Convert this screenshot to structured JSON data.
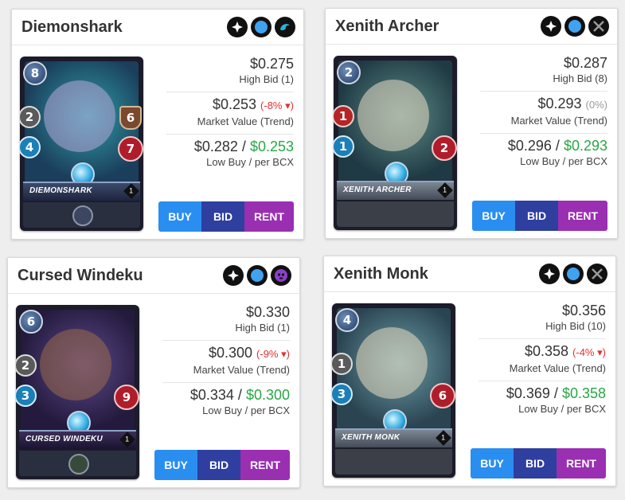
{
  "colors": {
    "buy": "#2a8ef0",
    "bid": "#2f3f9f",
    "rent": "#9a2fb2",
    "trend_negative": "#e03131",
    "low_buy_green": "#28a745"
  },
  "cards": [
    {
      "title": "Diemonshark",
      "card_name": "DIEMONSHARK",
      "level": "1",
      "icons": [
        "water-splash-icon",
        "blue-element-icon",
        "wave-icon"
      ],
      "stats": {
        "mana": "8",
        "attack": "2",
        "attack_type": "melee",
        "speed": "4",
        "armor": "6",
        "health": "7"
      },
      "high_bid": "$0.275",
      "high_bid_label": "High Bid (1)",
      "market_value": "$0.253",
      "trend": "(-8%",
      "trend_arrow": "▾",
      "trend_close": ")",
      "market_value_label": "Market Value (Trend)",
      "low_buy": "$0.282",
      "separator": " / ",
      "per_bcx": "$0.253",
      "low_buy_label": "Low Buy / per BCX",
      "buy_label": "BUY",
      "bid_label": "BID",
      "rent_label": "RENT"
    },
    {
      "title": "Xenith Archer",
      "card_name": "XENITH ARCHER",
      "level": "1",
      "icons": [
        "water-splash-icon",
        "blue-element-icon",
        "crossed-swords-icon"
      ],
      "stats": {
        "mana": "2",
        "attack": "1",
        "attack_type": "ranged",
        "speed": "1",
        "armor": "",
        "health": "2"
      },
      "high_bid": "$0.287",
      "high_bid_label": "High Bid (8)",
      "market_value": "$0.293",
      "trend": "(0%)",
      "trend_arrow": "",
      "trend_close": "",
      "market_value_label": "Market Value (Trend)",
      "low_buy": "$0.296",
      "separator": " / ",
      "per_bcx": "$0.293",
      "low_buy_label": "Low Buy / per BCX",
      "buy_label": "BUY",
      "bid_label": "BID",
      "rent_label": "RENT"
    },
    {
      "title": "Cursed Windeku",
      "card_name": "CURSED WINDEKU",
      "level": "1",
      "icons": [
        "water-splash-icon",
        "blue-element-icon",
        "skull-icon"
      ],
      "stats": {
        "mana": "6",
        "attack": "2",
        "attack_type": "melee",
        "speed": "3",
        "armor": "",
        "health": "9"
      },
      "high_bid": "$0.330",
      "high_bid_label": "High Bid (1)",
      "market_value": "$0.300",
      "trend": "(-9%",
      "trend_arrow": "▾",
      "trend_close": ")",
      "market_value_label": "Market Value (Trend)",
      "low_buy": "$0.334",
      "separator": " / ",
      "per_bcx": "$0.300",
      "low_buy_label": "Low Buy / per BCX",
      "buy_label": "BUY",
      "bid_label": "BID",
      "rent_label": "RENT"
    },
    {
      "title": "Xenith Monk",
      "card_name": "XENITH MONK",
      "level": "1",
      "icons": [
        "water-splash-icon",
        "blue-element-icon",
        "crossed-swords-icon"
      ],
      "stats": {
        "mana": "4",
        "attack": "1",
        "attack_type": "melee",
        "speed": "3",
        "armor": "",
        "health": "6"
      },
      "high_bid": "$0.356",
      "high_bid_label": "High Bid (10)",
      "market_value": "$0.358",
      "trend": "(-4%",
      "trend_arrow": "▾",
      "trend_close": ")",
      "market_value_label": "Market Value (Trend)",
      "low_buy": "$0.369",
      "separator": " / ",
      "per_bcx": "$0.358",
      "low_buy_label": "Low Buy / per BCX",
      "buy_label": "BUY",
      "bid_label": "BID",
      "rent_label": "RENT"
    }
  ]
}
